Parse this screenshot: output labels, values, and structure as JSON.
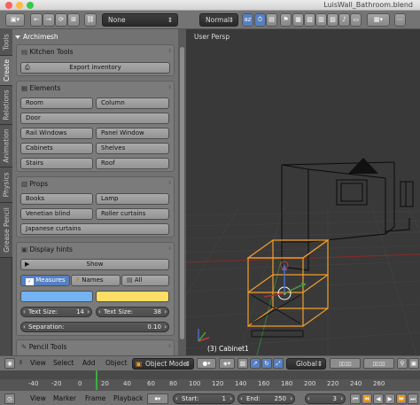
{
  "window": {
    "title": "LuisWall_Bathroom.blend"
  },
  "header": {
    "view_type": "None",
    "blend_mode": "Normal"
  },
  "tabs": [
    "Tools",
    "Create",
    "Relations",
    "Animation",
    "Physics",
    "Grease Pencil"
  ],
  "panel": {
    "title": "Archimesh",
    "kitchen": {
      "label": "Kitchen Tools",
      "export": "Export inventory"
    },
    "elements": {
      "label": "Elements",
      "room": "Room",
      "column": "Column",
      "door": "Door",
      "rail_windows": "Rail Windows",
      "panel_window": "Panel Window",
      "cabinets": "Cabinets",
      "shelves": "Shelves",
      "stairs": "Stairs",
      "roof": "Roof"
    },
    "props": {
      "label": "Props",
      "books": "Books",
      "lamp": "Lamp",
      "venetian": "Venetian blind",
      "roller": "Roller curtains",
      "japanese": "Japanese curtains"
    },
    "display": {
      "label": "Display hints",
      "show": "Show",
      "measures": "Measures",
      "names": "Names",
      "all": "All",
      "text_size_1_label": "Text Size:",
      "text_size_1_value": "14",
      "text_size_2_label": "Text Size:",
      "text_size_2_value": "38",
      "separation_label": "Separation:",
      "separation_value": "0.10",
      "color_1": "#74b2f2",
      "color_2": "#fede65"
    },
    "pencil": {
      "label": "Pencil Tools"
    }
  },
  "viewport": {
    "title": "User Persp",
    "status": "(3) Cabinet1",
    "selection_color": "#f29e29"
  },
  "toolbar": {
    "view": "View",
    "select": "Select",
    "add": "Add",
    "object": "Object",
    "mode": "Object Mode",
    "orientation": "Global"
  },
  "timeline": {
    "ticks": [
      "-40",
      "-20",
      "0",
      "20",
      "40",
      "60",
      "80",
      "100",
      "120",
      "140",
      "160",
      "180",
      "200",
      "220",
      "240",
      "260"
    ]
  },
  "footer": {
    "view": "View",
    "marker": "Marker",
    "frame": "Frame",
    "playback": "Playback",
    "start_label": "Start:",
    "start_value": "1",
    "end_label": "End:",
    "end_value": "250",
    "current_value": "3"
  }
}
